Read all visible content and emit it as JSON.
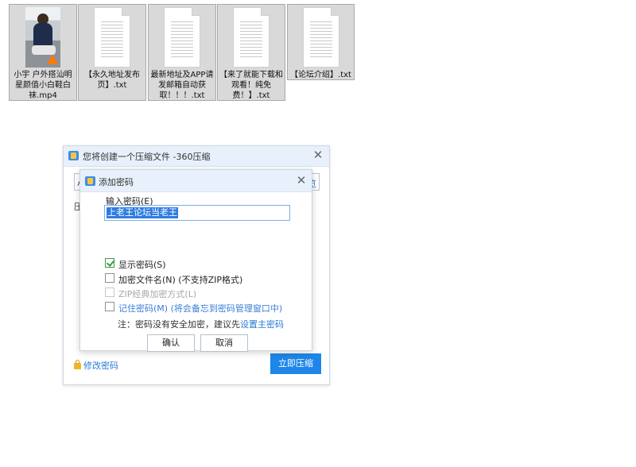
{
  "files": [
    {
      "name": "小宇 户外搭汕明星颜值小白鞋白袜.mp4",
      "type": "video",
      "selected": false
    },
    {
      "name": "【永久地址发布页】.txt",
      "type": "txt",
      "selected": false
    },
    {
      "name": "最新地址及APP请发邮箱自动获取！！！.txt",
      "type": "txt",
      "selected": false
    },
    {
      "name": "【来了就能下载和观看！纯免费！】.txt",
      "type": "txt",
      "selected": false
    },
    {
      "name": "【论坛介绍】.txt",
      "type": "txt",
      "selected": false
    }
  ],
  "main_dialog": {
    "title": "您将创建一个压缩文件 -360压缩",
    "path_left": "小",
    "path_right": "览",
    "label": "压",
    "modify_password": "修改密码",
    "compress_button": "立即压缩"
  },
  "password_dialog": {
    "title": "添加密码",
    "input_label": "输入密码(E)",
    "password_value": "上老王论坛当老王",
    "options": {
      "show_password": {
        "label": "显示密码(S)",
        "checked": true
      },
      "encrypt_filename": {
        "label": "加密文件名(N) (不支持ZIP格式)",
        "checked": false
      },
      "zip_classic": {
        "label": "ZIP经典加密方式(L)",
        "checked": false,
        "disabled": true
      },
      "remember_password": {
        "label": "记住密码(M) (将会备忘到密码管理窗口中)",
        "checked": false
      }
    },
    "note_prefix": "注：密码没有安全加密，建议先",
    "note_link": "设置主密码",
    "ok_label": "确认",
    "cancel_label": "取消"
  },
  "colors": {
    "title_bar": "#e8f1fb",
    "accent_blue": "#1e86e8",
    "link_blue": "#2a7ad5",
    "check_green": "#3a9a44",
    "file_tile_bg": "#d9d9d9"
  },
  "icons": {
    "close": "close-icon",
    "app": "360zip-icon",
    "lock": "lock-icon",
    "checkbox_checked": "checkmark-icon"
  }
}
